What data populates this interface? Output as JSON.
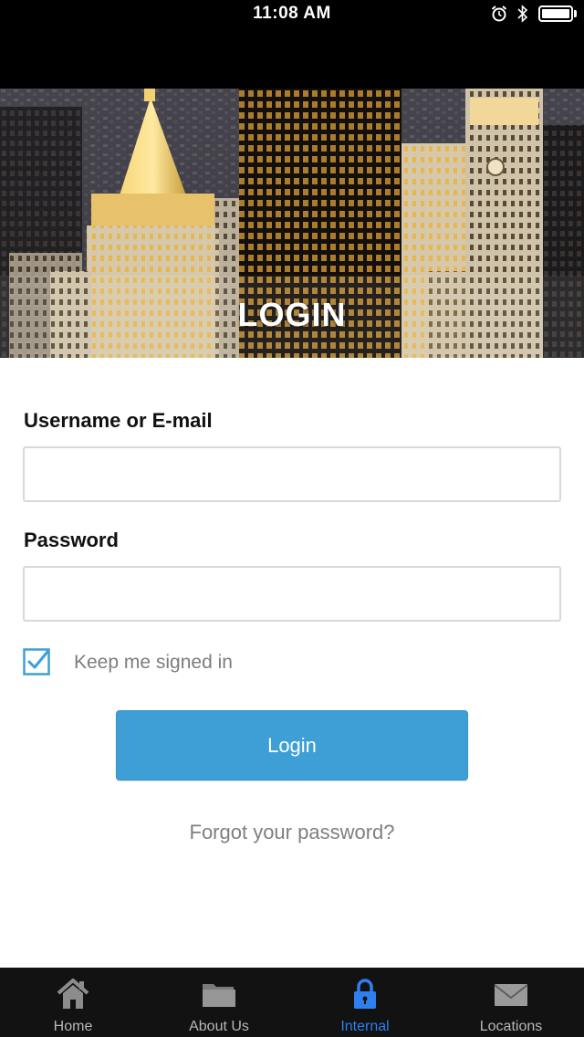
{
  "status_bar": {
    "time": "11:08 AM"
  },
  "hero": {
    "title": "LOGIN"
  },
  "form": {
    "username_label": "Username or E-mail",
    "username_value": "",
    "password_label": "Password",
    "password_value": "",
    "keep_signed_in_label": "Keep me signed in",
    "keep_signed_in_checked": true,
    "login_button_label": "Login",
    "forgot_link": "Forgot your password?"
  },
  "colors": {
    "accent": "#3e9fd6",
    "tab_active": "#2e7ff0",
    "tab_inactive": "#b7b7b7",
    "tab_bar_bg": "#121212"
  },
  "tab_bar": {
    "tabs": [
      {
        "label": "Home",
        "icon": "house-icon",
        "active": false
      },
      {
        "label": "About Us",
        "icon": "folder-icon",
        "active": false
      },
      {
        "label": "Internal",
        "icon": "lock-icon",
        "active": true
      },
      {
        "label": "Locations",
        "icon": "envelope-icon",
        "active": false
      }
    ]
  }
}
